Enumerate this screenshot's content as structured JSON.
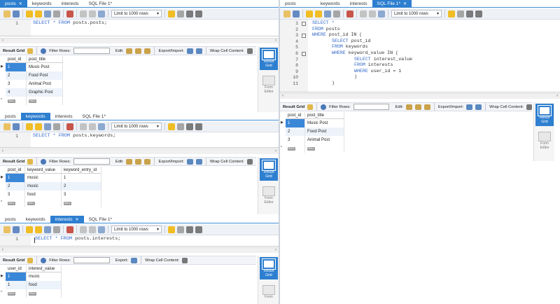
{
  "toolbar": {
    "limit": "Limit to 1000 rows"
  },
  "result_bar": {
    "result_grid": "Result Grid",
    "filter_rows": "Filter Rows:",
    "edit": "Edit:",
    "export_import": "Export/Import:",
    "export": "Export:",
    "wrap": "Wrap Cell Content:"
  },
  "side": {
    "result_grid": [
      "Result",
      "Grid"
    ],
    "form_editor": [
      "Form",
      "Editor"
    ],
    "form": "Form"
  },
  "null_label": "NULL",
  "p1": {
    "tabs": [
      "posts",
      "keywords",
      "interests",
      "SQL File 1*"
    ],
    "editor": {
      "line": "1",
      "code_kw": "SELECT * FROM",
      "code_rest": " posts.posts;"
    },
    "columns": [
      "post_id",
      "post_title"
    ],
    "rows": [
      [
        "1",
        "Music Post"
      ],
      [
        "2",
        "Food Post"
      ],
      [
        "3",
        "Animal Post"
      ],
      [
        "4",
        "Graphic Post"
      ]
    ]
  },
  "p2": {
    "tabs": [
      "posts",
      "keywords",
      "interests",
      "SQL File 1*"
    ],
    "editor": {
      "line": "1",
      "code_kw": "SELECT * FROM",
      "code_rest": " posts.keywords;"
    },
    "columns": [
      "post_id",
      "keyword_value",
      "keyword_entry_id"
    ],
    "rows": [
      [
        "1",
        "music",
        "1"
      ],
      [
        "2",
        "music",
        "2"
      ],
      [
        "3",
        "food",
        "3"
      ]
    ]
  },
  "p3": {
    "tabs": [
      "posts",
      "keywords",
      "interests",
      "SQL File 1*"
    ],
    "editor": {
      "line": "1",
      "code_kw": "SELECT * FROM",
      "code_rest": " posts.interests;"
    },
    "columns": [
      "user_id",
      "interest_value"
    ],
    "rows": [
      [
        "1",
        "music"
      ],
      [
        "1",
        "food"
      ]
    ]
  },
  "p4": {
    "tabs": [
      "posts",
      "keywords",
      "interests",
      "SQL File 1*"
    ],
    "editor": {
      "line_numbers": [
        "1",
        "2",
        "3",
        "4",
        "5",
        "6",
        "7",
        "8",
        "9",
        "10",
        "11"
      ],
      "lines": [
        {
          "kw": "SELECT *",
          "rest": ""
        },
        {
          "kw": "FROM",
          "rest": " posts"
        },
        {
          "kw": "WHERE",
          "rest": " post_id IN ("
        },
        {
          "kw": "SELECT",
          "rest": " post_id"
        },
        {
          "kw": "FROM",
          "rest": " keywords"
        },
        {
          "kw": "WHERE",
          "rest": " keyword_value IN ("
        },
        {
          "kw": "SELECT",
          "rest": " interest_value"
        },
        {
          "kw": "FROM",
          "rest": " interests"
        },
        {
          "kw": "WHERE",
          "rest": " user_id = 1"
        },
        {
          "kw": "",
          "rest": ")"
        },
        {
          "kw": "",
          "rest": ")"
        }
      ]
    },
    "columns": [
      "post_id",
      "post_title"
    ],
    "rows": [
      [
        "1",
        "Music Post"
      ],
      [
        "2",
        "Food Post"
      ],
      [
        "3",
        "Animal Post"
      ]
    ]
  },
  "colors": {
    "accent": "#2e7fd0",
    "selected_cell": "#3a87d8",
    "keyword": "#2d64c9",
    "alt_row": "#edf3fb"
  }
}
